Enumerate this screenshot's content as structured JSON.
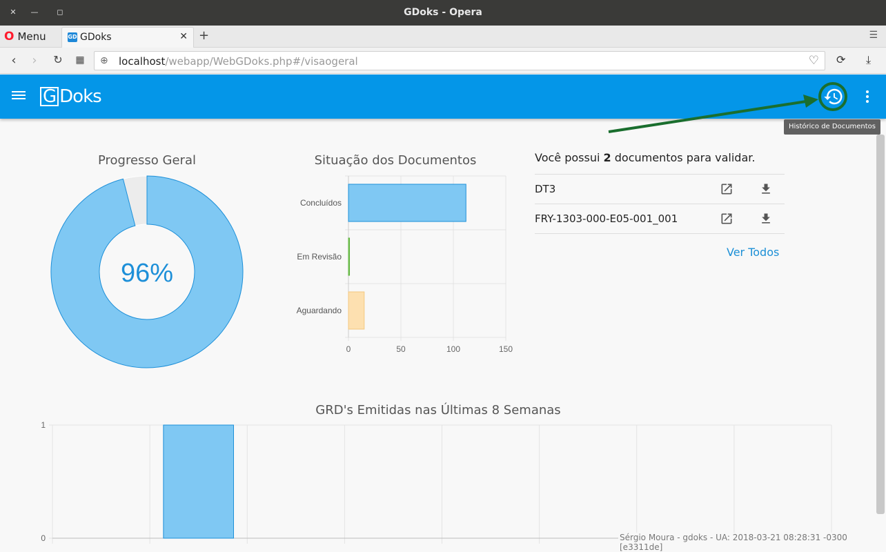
{
  "window": {
    "title": "GDoks - Opera"
  },
  "tabbar": {
    "menu_label": "Menu",
    "tab_title": "GDoks"
  },
  "address": {
    "host": "localhost",
    "path": "/webapp/WebGDoks.php#/visaogeral"
  },
  "app": {
    "logo_g": "G",
    "logo_rest": "Doks",
    "history_tooltip": "Histórico de Documentos"
  },
  "progress": {
    "title": "Progresso Geral",
    "label": "96%",
    "value": 96,
    "color": "#7fc8f3",
    "stroke": "#1d8fd8",
    "rest_color": "#ececec"
  },
  "situacao": {
    "title": "Situação dos Documentos",
    "chart_data": {
      "type": "bar",
      "orientation": "horizontal",
      "categories": [
        "Concluídos",
        "Em Revisão",
        "Aguardando"
      ],
      "values": [
        112,
        1,
        15
      ],
      "colors": [
        "#7fc8f3",
        "#8ed36b",
        "#fde0b0"
      ],
      "borders": [
        "#1d8fd8",
        "#5cb23c",
        "#f3c980"
      ],
      "xlim": [
        0,
        150
      ],
      "ticks": [
        "0",
        "50",
        "100",
        "150"
      ]
    }
  },
  "validation": {
    "text_before": "Você possui",
    "count": "2",
    "text_after": "documentos para validar.",
    "docs": [
      {
        "name": "DT3"
      },
      {
        "name": "FRY-1303-000-E05-001_001"
      }
    ],
    "see_all": "Ver Todos"
  },
  "grd": {
    "title": "GRD's Emitidas nas Últimas 8 Semanas",
    "chart_data": {
      "type": "bar",
      "categories": [
        "",
        "",
        "",
        "",
        "",
        "",
        "",
        ""
      ],
      "values": [
        0,
        1,
        0,
        0,
        0,
        0,
        0,
        0
      ],
      "ylim": [
        0,
        1
      ],
      "yticks": [
        "0",
        "1"
      ],
      "color": "#7fc8f3",
      "border": "#1d8fd8"
    }
  },
  "footer": {
    "text": "Sérgio Moura - gdoks - UA: 2018-03-21 08:28:31 -0300 [e3311de]"
  }
}
